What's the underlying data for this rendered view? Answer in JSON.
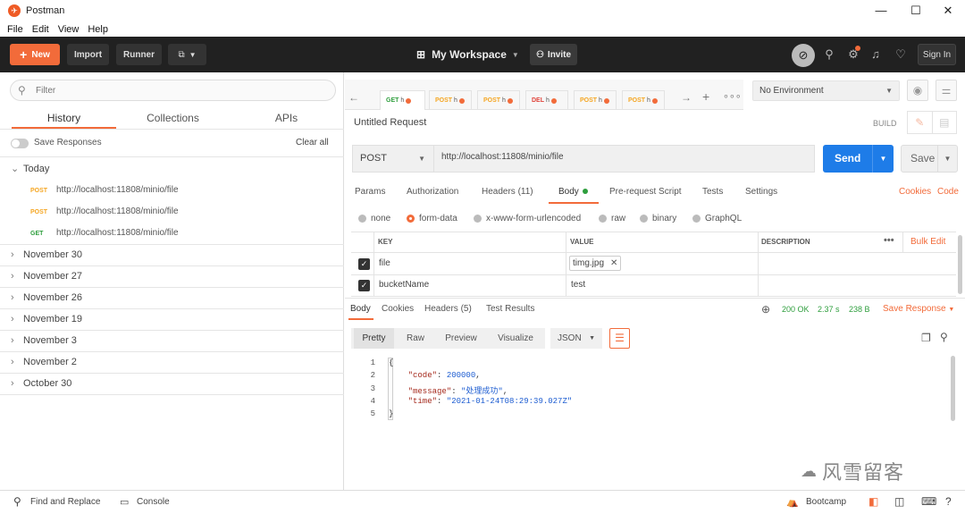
{
  "window": {
    "app_title": "Postman",
    "minimize": "—",
    "maximize": "☐",
    "close": "✕"
  },
  "menu": [
    "File",
    "Edit",
    "View",
    "Help"
  ],
  "header": {
    "new_label": "New",
    "import_label": "Import",
    "runner_label": "Runner",
    "workspace": "My Workspace",
    "invite_label": "Invite",
    "signin_label": "Sign In"
  },
  "sidebar": {
    "filter_placeholder": "Filter",
    "tabs": [
      "History",
      "Collections",
      "APIs"
    ],
    "save_responses": "Save Responses",
    "clear_all": "Clear all",
    "today_label": "Today",
    "today_items": [
      {
        "method": "POST",
        "url": "http://localhost:11808/minio/file"
      },
      {
        "method": "POST",
        "url": "http://localhost:11808/minio/file"
      },
      {
        "method": "GET",
        "url": "http://localhost:11808/minio/file"
      }
    ],
    "groups": [
      "November 30",
      "November 27",
      "November 26",
      "November 19",
      "November 3",
      "November 2",
      "October 30"
    ]
  },
  "request_tabs": [
    {
      "method": "GET",
      "name": "h"
    },
    {
      "method": "POST",
      "name": "h"
    },
    {
      "method": "POST",
      "name": "h"
    },
    {
      "method": "DEL",
      "name": "h"
    },
    {
      "method": "POST",
      "name": "h"
    },
    {
      "method": "POST",
      "name": "h"
    }
  ],
  "environment": "No Environment",
  "request": {
    "name": "Untitled Request",
    "build_label": "BUILD",
    "method": "POST",
    "url": "http://localhost:11808/minio/file",
    "send_label": "Send",
    "save_label": "Save",
    "subtabs": [
      "Params",
      "Authorization",
      "Headers (11)",
      "Body",
      "Pre-request Script",
      "Tests",
      "Settings"
    ],
    "cookies_label": "Cookies",
    "code_label": "Code",
    "body_modes": [
      "none",
      "form-data",
      "x-www-form-urlencoded",
      "raw",
      "binary",
      "GraphQL"
    ],
    "table_headers": {
      "key": "KEY",
      "value": "VALUE",
      "description": "DESCRIPTION",
      "bulk_edit": "Bulk Edit"
    },
    "rows": [
      {
        "key": "file",
        "value": "timg.jpg"
      },
      {
        "key": "bucketName",
        "value": "test"
      }
    ]
  },
  "response": {
    "tabs": [
      "Body",
      "Cookies",
      "Headers (5)",
      "Test Results"
    ],
    "status": "200 OK",
    "time": "2.37 s",
    "size": "238 B",
    "save_response": "Save Response",
    "views": [
      "Pretty",
      "Raw",
      "Preview",
      "Visualize"
    ],
    "format": "JSON",
    "lines": [
      "{",
      "    \"code\": 200000,",
      "    \"message\": \"处理成功\",",
      "    \"time\": \"2021-01-24T08:29:39.027Z\"",
      "}"
    ],
    "json": {
      "code_key": "\"code\"",
      "code_val": "200000",
      "message_key": "\"message\"",
      "message_val": "\"处理成功\"",
      "time_key": "\"time\"",
      "time_val": "\"2021-01-24T08:29:39.027Z\""
    }
  },
  "footer": {
    "find_replace": "Find and Replace",
    "console": "Console",
    "bootcamp": "Bootcamp"
  },
  "watermark": "风雪留客",
  "colors": {
    "accent": "#f26b3a",
    "send": "#1e7ce8",
    "status_ok": "#2e9e3d",
    "post": "#f5a623",
    "get": "#2e9e3d",
    "del": "#e0433a"
  }
}
